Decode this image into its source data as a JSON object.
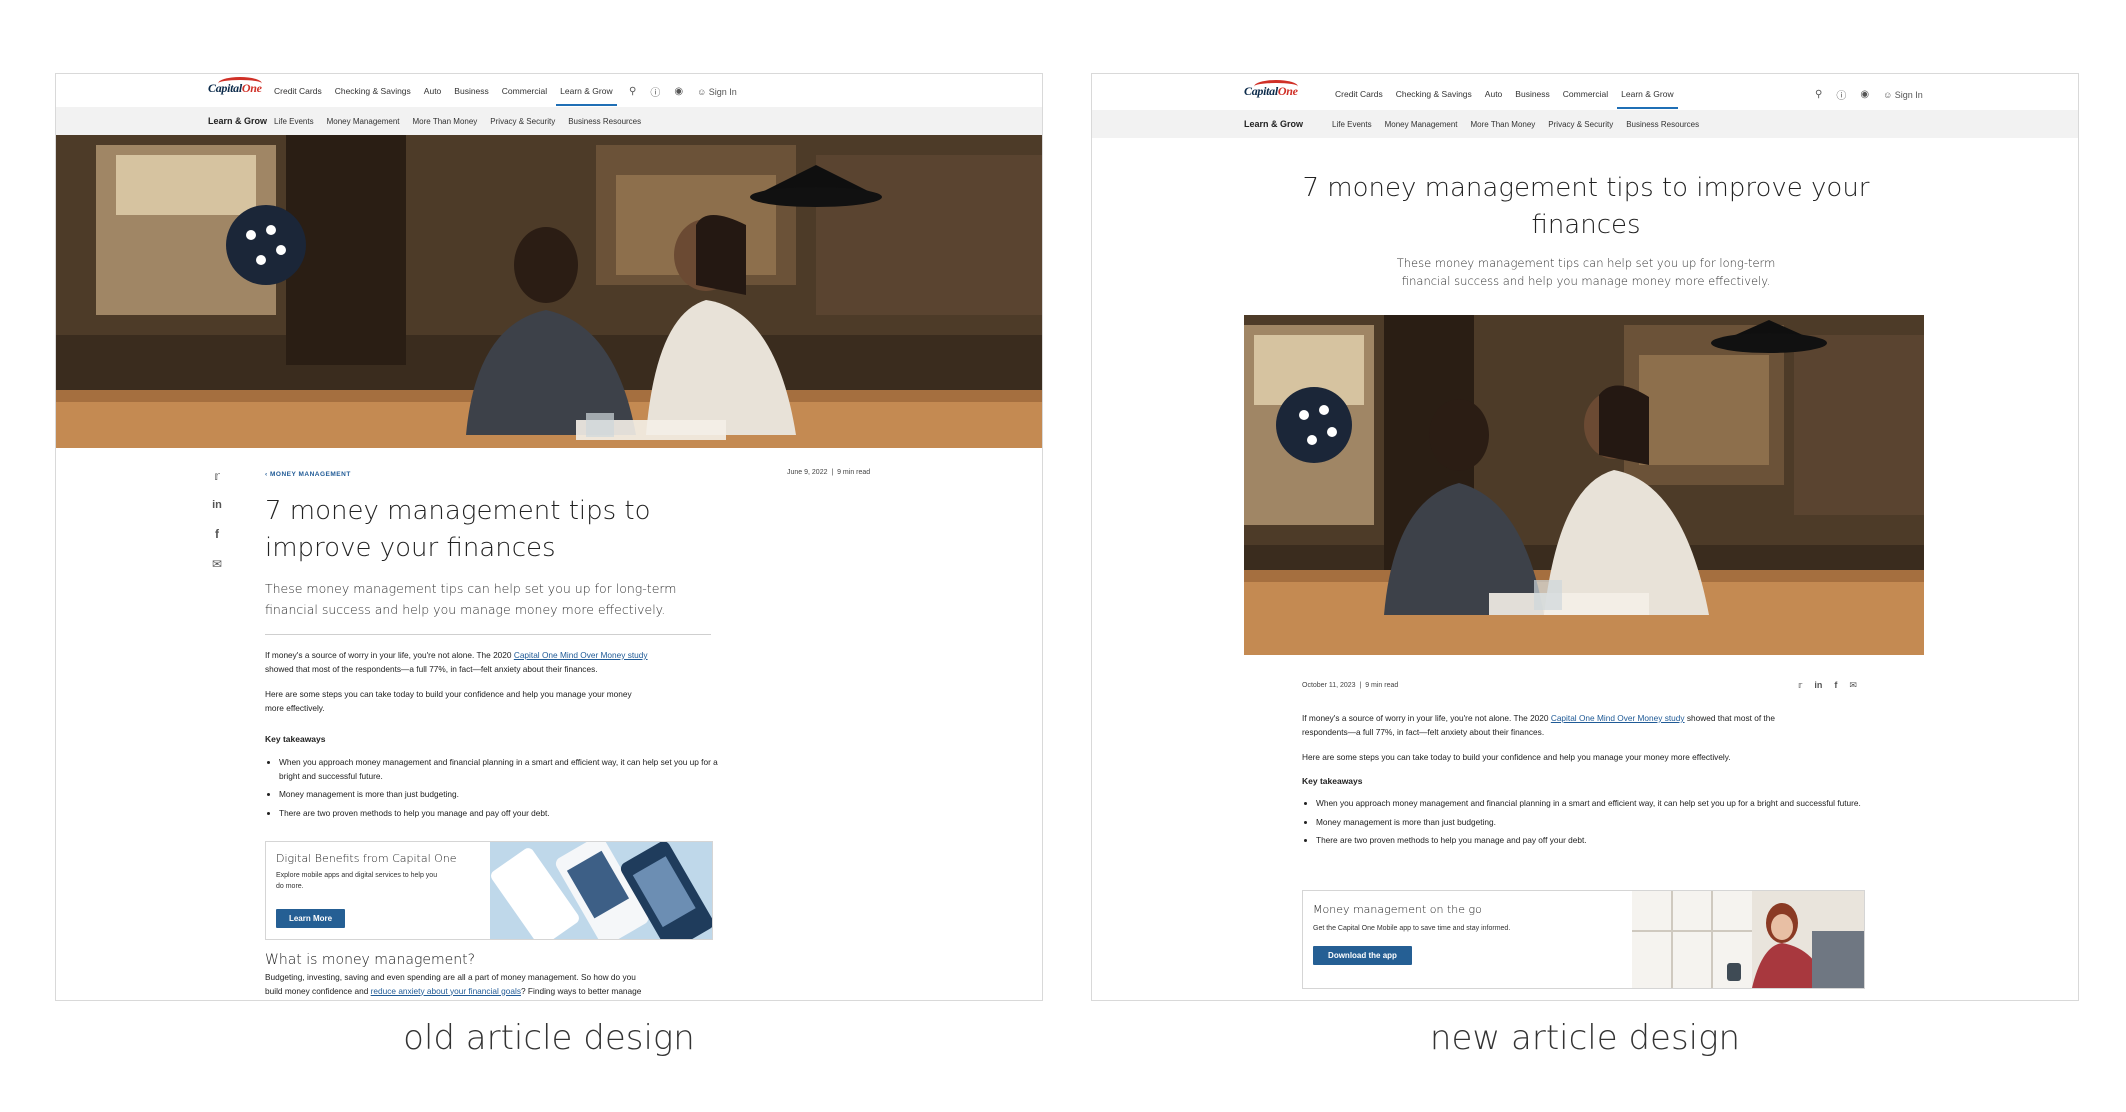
{
  "brand": {
    "logo_text": "Capital",
    "logo_one": "One",
    "accent": "#d03027",
    "link_color": "#1f5a96",
    "button_color": "#255f94"
  },
  "nav": {
    "links": [
      "Credit Cards",
      "Checking & Savings",
      "Auto",
      "Business",
      "Commercial",
      "Learn & Grow"
    ],
    "active": "Learn & Grow",
    "icons": [
      "search-icon",
      "help-icon",
      "location-icon",
      "user-icon"
    ],
    "signin": "Sign In"
  },
  "subnav": {
    "title": "Learn & Grow",
    "links": [
      "Life Events",
      "Money Management",
      "More Than Money",
      "Privacy & Security",
      "Business Resources"
    ]
  },
  "old": {
    "caption": "old article design",
    "kicker": "MONEY MANAGEMENT",
    "date": "June 9, 2022",
    "read_time": "9 min read",
    "title_line1": "7 money management tips to",
    "title_line2": "improve your finances",
    "dek_line1": "These money management tips can help set you up for long-term",
    "dek_line2": "financial success and help you manage money more effectively.",
    "share_icons": [
      "twitter-icon",
      "linkedin-icon",
      "facebook-icon",
      "email-icon"
    ],
    "para1_line1_pre": "If money's a source of worry in your life, you're not alone. The 2020 ",
    "para1_link": "Capital One Mind Over Money study",
    "para1_line2": "showed that most of the respondents—a full 77%, in fact—felt anxiety about their finances.",
    "para2_line1": "Here are some steps you can take today to build your confidence and help you manage your money",
    "para2_line2": "more effectively.",
    "key_takeaways": "Key takeaways",
    "bullets": [
      "When you approach money management and financial planning in a smart and efficient way, it can help set you up for a bright and successful future.",
      "Money management is more than just budgeting.",
      "There are two proven methods to help you manage and pay off your debt."
    ],
    "promo": {
      "title": "Digital Benefits from Capital One",
      "text_line1": "Explore mobile apps and digital services to help you",
      "text_line2": "do more.",
      "button": "Learn More"
    },
    "h2": "What is money management?",
    "para3_line1": "Budgeting, investing, saving and even spending are all a part of money management. So how do you",
    "para3_line2_pre": "build money confidence and ",
    "para3_link": "reduce anxiety about your financial goals",
    "para3_line2_post": "? Finding ways to better manage"
  },
  "new": {
    "caption": "new article design",
    "title_line1": "7 money management tips to improve your",
    "title_line2": "finances",
    "dek_line1": "These money management tips can help set you up for long-term",
    "dek_line2": "financial success and help you manage money more effectively.",
    "date": "October 11, 2023",
    "read_time": "9 min read",
    "share_icons": [
      "twitter-icon",
      "linkedin-icon",
      "facebook-icon",
      "email-icon"
    ],
    "para1_line1_pre": "If money's a source of worry in your life, you're not alone. The 2020 ",
    "para1_link": "Capital One Mind Over Money study",
    "para1_line1_post": " showed that most of the",
    "para1_line2": "respondents—a full 77%, in fact—felt anxiety about their finances.",
    "para2": "Here are some steps you can take today to build your confidence and help you manage your money more effectively.",
    "key_takeaways": "Key takeaways",
    "bullets": [
      "When you approach money management and financial planning in a smart and efficient way, it can help set you up for a bright and successful future.",
      "Money management is more than just budgeting.",
      "There are two proven methods to help you manage and pay off your debt."
    ],
    "promo": {
      "title": "Money management on the go",
      "text": "Get the Capital One Mobile app to save time and stay informed.",
      "button": "Download the app"
    }
  }
}
